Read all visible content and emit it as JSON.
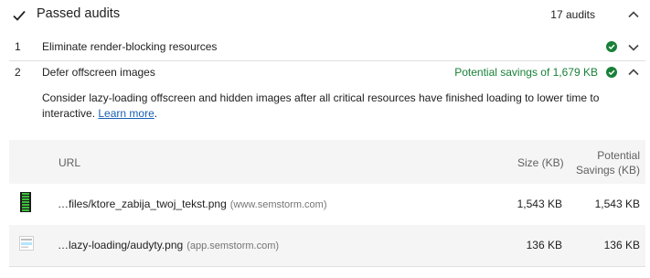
{
  "group": {
    "title": "Passed audits",
    "count": "17 audits"
  },
  "audits": [
    {
      "num": "1",
      "title": "Eliminate render-blocking resources"
    },
    {
      "num": "2",
      "title": "Defer offscreen images",
      "savings": "Potential savings of 1,679 KB"
    }
  ],
  "description": {
    "text": "Consider lazy-loading offscreen and hidden images after all critical resources have finished loading to lower time to interactive.",
    "link": "Learn more",
    "trail": "."
  },
  "table": {
    "headers": {
      "url": "URL",
      "size": "Size (KB)",
      "savings_line1": "Potential",
      "savings_line2": "Savings (KB)"
    },
    "rows": [
      {
        "path": "…files/ktore_zabija_twoj_tekst.png",
        "host": "(www.semstorm.com)",
        "size": "1,543 KB",
        "savings": "1,543 KB"
      },
      {
        "path": "…lazy-loading/audyty.png",
        "host": "(app.semstorm.com)",
        "size": "136 KB",
        "savings": "136 KB"
      }
    ]
  },
  "colors": {
    "pass": "#188038",
    "link": "#1a5fb4"
  }
}
